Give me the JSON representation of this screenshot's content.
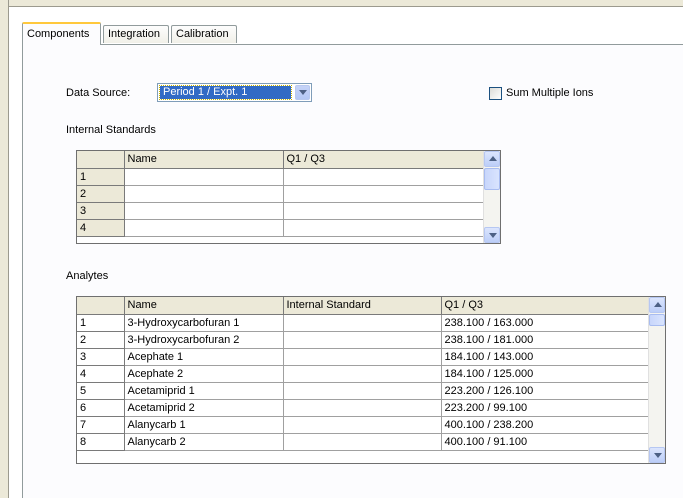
{
  "tabs": [
    {
      "label": "Components",
      "active": true
    },
    {
      "label": "Integration",
      "active": false
    },
    {
      "label": "Calibration",
      "active": false
    }
  ],
  "data_source": {
    "label": "Data Source:",
    "value": "Period 1 / Expt. 1"
  },
  "sum_multiple_ions": {
    "label": "Sum Multiple Ions",
    "checked": false
  },
  "internal_standards": {
    "title": "Internal Standards",
    "columns": [
      "Name",
      "Q1 / Q3"
    ],
    "rows": [
      {
        "num": "1",
        "name": "",
        "q1q3": ""
      },
      {
        "num": "2",
        "name": "",
        "q1q3": ""
      },
      {
        "num": "3",
        "name": "",
        "q1q3": ""
      },
      {
        "num": "4",
        "name": "",
        "q1q3": ""
      }
    ]
  },
  "analytes": {
    "title": "Analytes",
    "columns": [
      "Name",
      "Internal Standard",
      "Q1 / Q3"
    ],
    "rows": [
      {
        "num": "1",
        "name": "3-Hydroxycarbofuran 1",
        "istd": "",
        "q1q3": "238.100 / 163.000"
      },
      {
        "num": "2",
        "name": "3-Hydroxycarbofuran 2",
        "istd": "",
        "q1q3": "238.100 / 181.000"
      },
      {
        "num": "3",
        "name": "Acephate 1",
        "istd": "",
        "q1q3": "184.100 / 143.000"
      },
      {
        "num": "4",
        "name": "Acephate 2",
        "istd": "",
        "q1q3": "184.100 / 125.000"
      },
      {
        "num": "5",
        "name": "Acetamiprid 1",
        "istd": "",
        "q1q3": "223.200 / 126.100"
      },
      {
        "num": "6",
        "name": "Acetamiprid 2",
        "istd": "",
        "q1q3": "223.200 / 99.100"
      },
      {
        "num": "7",
        "name": "Alanycarb 1",
        "istd": "",
        "q1q3": "400.100 / 238.200"
      },
      {
        "num": "8",
        "name": "Alanycarb 2",
        "istd": "",
        "q1q3": "400.100 / 91.100"
      }
    ]
  }
}
